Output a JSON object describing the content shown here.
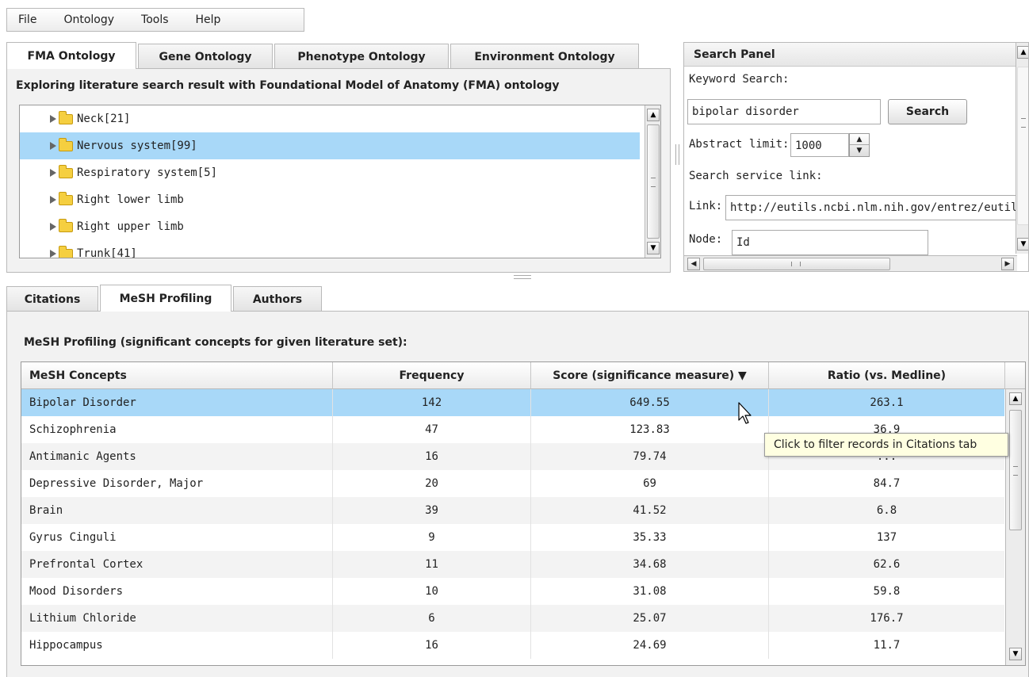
{
  "menu": [
    "File",
    "Ontology",
    "Tools",
    "Help"
  ],
  "ontology_tabs": [
    {
      "label": "FMA Ontology",
      "active": true
    },
    {
      "label": "Gene Ontology",
      "active": false
    },
    {
      "label": "Phenotype Ontology",
      "active": false
    },
    {
      "label": "Environment Ontology",
      "active": false
    }
  ],
  "ontology_heading": "Exploring literature search result with Foundational Model of Anatomy (FMA) ontology",
  "tree_items": [
    {
      "label": "Neck[21]",
      "selected": false
    },
    {
      "label": "Nervous system[99]",
      "selected": true
    },
    {
      "label": "Respiratory system[5]",
      "selected": false
    },
    {
      "label": "Right lower limb",
      "selected": false
    },
    {
      "label": "Right upper limb",
      "selected": false
    },
    {
      "label": "Trunk[41]",
      "selected": false
    }
  ],
  "search_panel": {
    "title": "Search Panel",
    "keyword_label": "Keyword Search:",
    "keyword_value": "bipolar disorder",
    "search_button": "Search",
    "abstract_label": "Abstract limit:",
    "abstract_value": "1000",
    "service_label": "Search service link:",
    "link_label": "Link:",
    "link_value": "http://eutils.ncbi.nlm.nih.gov/entrez/eutils",
    "node_label": "Node:",
    "node_value": "Id"
  },
  "result_tabs": [
    {
      "label": "Citations",
      "active": false
    },
    {
      "label": "MeSH Profiling",
      "active": true
    },
    {
      "label": "Authors",
      "active": false
    }
  ],
  "mesh_heading": "MeSH Profiling (significant concepts for given literature set):",
  "table": {
    "columns": [
      "MeSH Concepts",
      "Frequency",
      "Score (significance measure) ▼",
      "Ratio (vs. Medline)"
    ],
    "rows": [
      {
        "concept": "Bipolar Disorder",
        "frequency": "142",
        "score": "649.55",
        "ratio": "263.1",
        "selected": true
      },
      {
        "concept": "Schizophrenia",
        "frequency": "47",
        "score": "123.83",
        "ratio": "36.9"
      },
      {
        "concept": "Antimanic Agents",
        "frequency": "16",
        "score": "79.74",
        "ratio": "..."
      },
      {
        "concept": "Depressive Disorder, Major",
        "frequency": "20",
        "score": "69",
        "ratio": "84.7"
      },
      {
        "concept": "Brain",
        "frequency": "39",
        "score": "41.52",
        "ratio": "6.8"
      },
      {
        "concept": "Gyrus Cinguli",
        "frequency": "9",
        "score": "35.33",
        "ratio": "137"
      },
      {
        "concept": "Prefrontal Cortex",
        "frequency": "11",
        "score": "34.68",
        "ratio": "62.6"
      },
      {
        "concept": "Mood Disorders",
        "frequency": "10",
        "score": "31.08",
        "ratio": "59.8"
      },
      {
        "concept": "Lithium Chloride",
        "frequency": "6",
        "score": "25.07",
        "ratio": "176.7"
      },
      {
        "concept": "Hippocampus",
        "frequency": "16",
        "score": "24.69",
        "ratio": "11.7"
      }
    ]
  },
  "tooltip": "Click to filter records in Citations tab",
  "colors": {
    "selection": "#a8d8f8",
    "tooltip_bg": "#ffffe1"
  }
}
